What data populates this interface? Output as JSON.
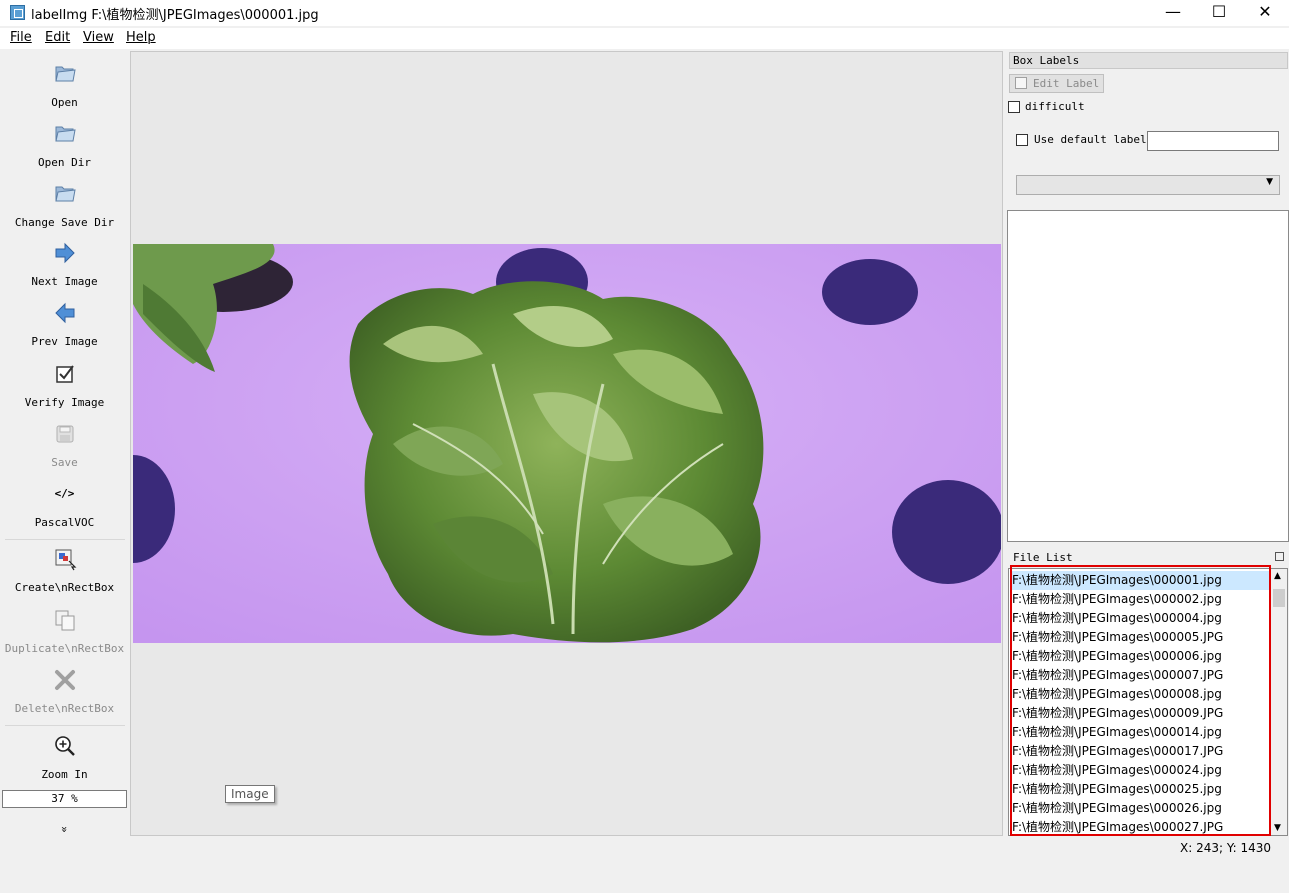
{
  "window": {
    "title": "labelImg F:\\植物检测\\JPEGImages\\000001.jpg",
    "minimize": "—",
    "maximize": "☐",
    "close": "✕"
  },
  "menu": [
    "File",
    "Edit",
    "View",
    "Help"
  ],
  "toolbar": {
    "open": "Open",
    "open_dir": "Open Dir",
    "change_save_dir": "Change Save Dir",
    "next_image": "Next Image",
    "prev_image": "Prev Image",
    "verify_image": "Verify Image",
    "save": "Save",
    "format_icon": "</>",
    "format": "PascalVOC",
    "create_rect": "Create\\nRectBox",
    "duplicate_rect": "Duplicate\\nRectBox",
    "delete_rect": "Delete\\nRectBox",
    "zoom_in": "Zoom In",
    "zoom_value": "37 %",
    "more": "»"
  },
  "canvas": {
    "tooltip": "Image"
  },
  "box_labels": {
    "title": "Box Labels",
    "edit_label": "Edit Label",
    "difficult": "difficult",
    "use_default_label": "Use default label",
    "default_label_value": ""
  },
  "file_list": {
    "title": "File List",
    "files": [
      "F:\\植物检测\\JPEGImages\\000001.jpg",
      "F:\\植物检测\\JPEGImages\\000002.jpg",
      "F:\\植物检测\\JPEGImages\\000004.jpg",
      "F:\\植物检测\\JPEGImages\\000005.JPG",
      "F:\\植物检测\\JPEGImages\\000006.jpg",
      "F:\\植物检测\\JPEGImages\\000007.JPG",
      "F:\\植物检测\\JPEGImages\\000008.jpg",
      "F:\\植物检测\\JPEGImages\\000009.JPG",
      "F:\\植物检测\\JPEGImages\\000014.jpg",
      "F:\\植物检测\\JPEGImages\\000017.JPG",
      "F:\\植物检测\\JPEGImages\\000024.jpg",
      "F:\\植物检测\\JPEGImages\\000025.jpg",
      "F:\\植物检测\\JPEGImages\\000026.jpg",
      "F:\\植物检测\\JPEGImages\\000027.JPG"
    ],
    "selected_index": 0
  },
  "status": {
    "coords": "X: 243; Y: 1430"
  },
  "colors": {
    "selection": "#cce8ff",
    "highlight": "#e00000",
    "background": "#c79af0"
  }
}
